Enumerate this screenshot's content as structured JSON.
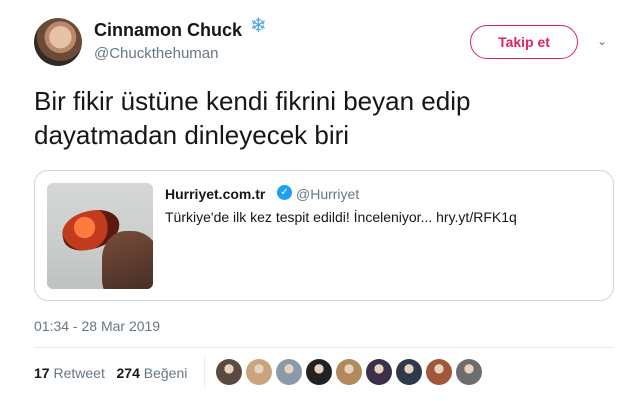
{
  "author": {
    "name": "Cinnamon Chuck",
    "badge_icon": "snowflake",
    "handle": "@Chuckthehuman"
  },
  "follow_label": "Takip et",
  "caret_icon": "chevron-down",
  "tweet": {
    "line1": "Bir fikir üstüne kendi fikrini beyan edip",
    "line2": "dayatmadan dinleyecek biri"
  },
  "quote": {
    "name": "Hurriyet.com.tr",
    "verified_icon": "verified-check",
    "handle": "@Hurriyet",
    "text": "Türkiye'de ilk kez tespit edildi! İnceleniyor... hry.yt/RFK1q"
  },
  "timestamp": "01:34 - 28 Mar 2019",
  "stats": {
    "retweet_count": "17",
    "retweet_label": "Retweet",
    "like_count": "274",
    "like_label": "Beğeni"
  },
  "likers": [
    {
      "color": "#5b4a3f"
    },
    {
      "color": "#c9a47e"
    },
    {
      "color": "#8a9aa8"
    },
    {
      "color": "#222222"
    },
    {
      "color": "#b08a5a"
    },
    {
      "color": "#3c2f4a"
    },
    {
      "color": "#2e3a4a"
    },
    {
      "color": "#a0583c"
    },
    {
      "color": "#6d6d6d"
    }
  ],
  "colors": {
    "accent": "#e0245e",
    "verified": "#1da1f2",
    "secondary_text": "#657786"
  }
}
